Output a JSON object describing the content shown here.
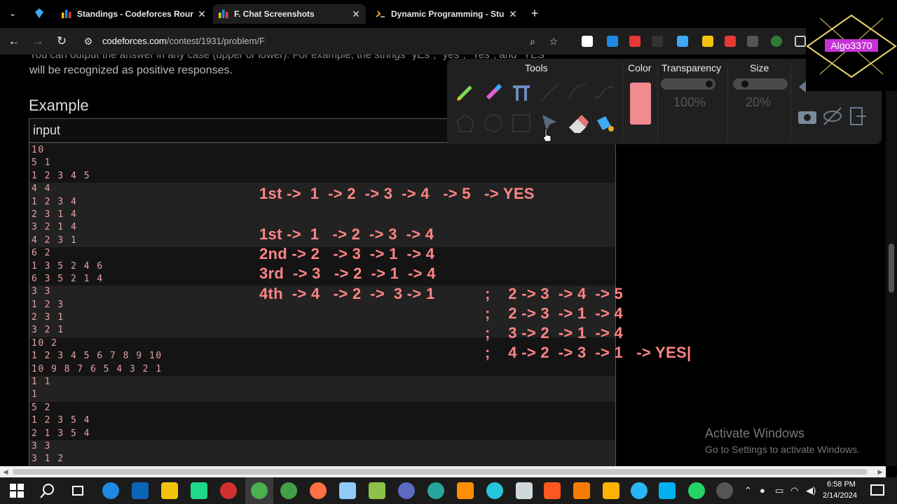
{
  "browser": {
    "tabs": [
      {
        "label": "Standings - Codeforces Round",
        "active": false
      },
      {
        "label": "F. Chat Screenshots",
        "active": true
      },
      {
        "label": "Dynamic Programming - Study",
        "active": false
      }
    ],
    "tab_close": "✕",
    "new_tab": "+",
    "url_domain": "codeforces.com",
    "url_path": "/contest/1931/problem/F"
  },
  "page": {
    "cut_text_1": "You can output the answer in any case (upper or lower). For example, the strings \"yEs\", \"yes\", \"Yes\", and \"YES\"",
    "cut_text_2": "will be recognized as positive responses.",
    "example_heading": "Example",
    "input_label": "input",
    "sample_input": [
      "10",
      "5 1",
      "1 2 3 4 5",
      "4 4",
      "1 2 3 4",
      "2 3 1 4",
      "3 2 1 4",
      "4 2 3 1",
      "6 2",
      "1 3 5 2 4 6",
      "6 3 5 2 1 4",
      "3 3",
      "1 2 3",
      "2 3 1",
      "3 2 1",
      "10 2",
      "1 2 3 4 5 6 7 8 9 10",
      "10 9 8 7 6 5 4 3 2 1",
      "1 1",
      "1",
      "5 2",
      "1 2 3 5 4",
      "2 1 3 5 4",
      "3 3",
      "3 1 2"
    ],
    "activate_title": "Activate Windows",
    "activate_sub": "Go to Settings to activate Windows."
  },
  "annotations": {
    "line1": "1st ->  1  -> 2  -> 3  -> 4   -> 5   -> YES",
    "line2": "1st ->  1   -> 2  -> 3  -> 4",
    "line3": "2nd -> 2   -> 3  -> 1  -> 4",
    "line4": "3rd  -> 3   -> 2  -> 1  -> 4",
    "line5": "4th  -> 4   -> 2  ->  3 -> 1",
    "right1": ";    2 -> 3  -> 4  -> 5",
    "right2": ";    2 -> 3  -> 1  -> 4",
    "right3": ";    3 -> 2  -> 1  -> 4",
    "right4": ";    4 -> 2  -> 3  -> 1   -> YES|"
  },
  "tool_palette": {
    "tools_label": "Tools",
    "color_label": "Color",
    "transparency_label": "Transparency",
    "size_label": "Size",
    "transparency_value": "100%",
    "size_value": "20%",
    "color": "#f28b8f"
  },
  "logo_text": "Algo3370",
  "taskbar": {
    "time": "6:58 PM",
    "date": "2/14/2024"
  }
}
